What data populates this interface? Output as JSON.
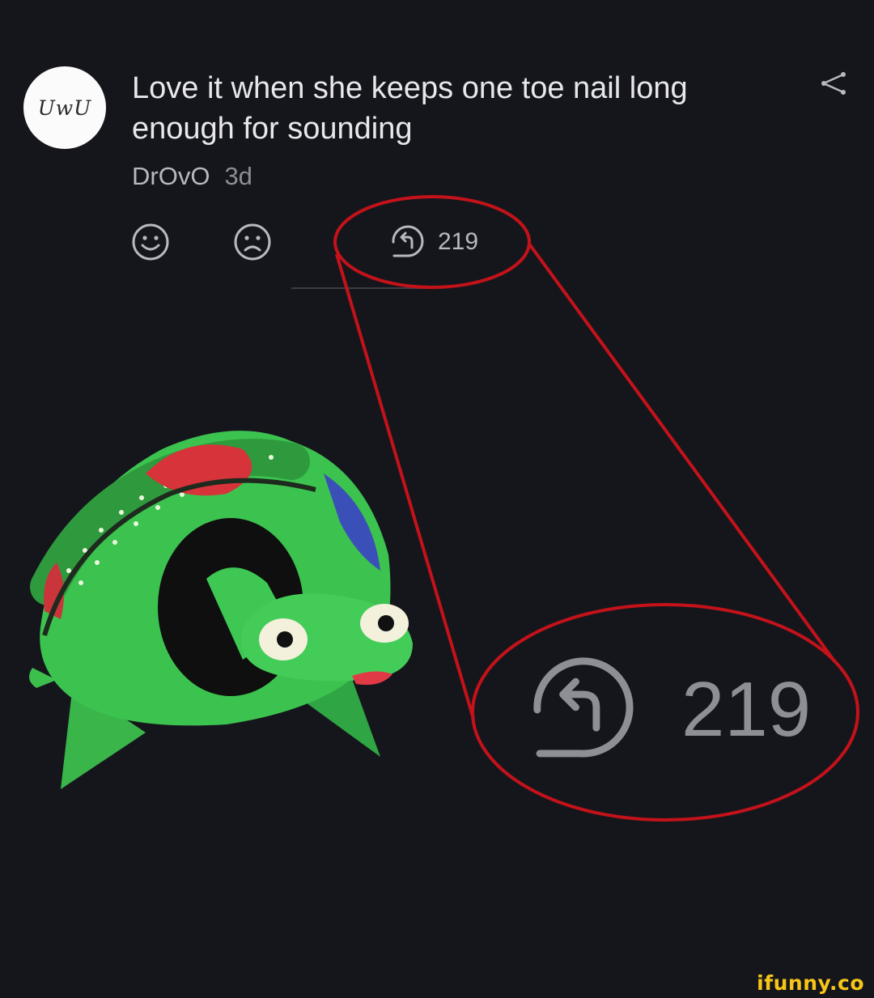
{
  "post": {
    "avatar_text": "UwU",
    "title": "Love it when she keeps one toe nail long enough for sounding",
    "author": "DrOvO",
    "time": "3d"
  },
  "actions": {
    "like_icon": "smile-face-icon",
    "dislike_icon": "sad-face-icon",
    "repost_icon": "repost-icon",
    "repost_count": "219",
    "share_icon": "share-icon"
  },
  "zoom": {
    "repost_count": "219"
  },
  "watermark": "ifunny.co",
  "colors": {
    "background": "#15161c",
    "annotation": "#c4121a",
    "watermark": "#f5c518"
  }
}
